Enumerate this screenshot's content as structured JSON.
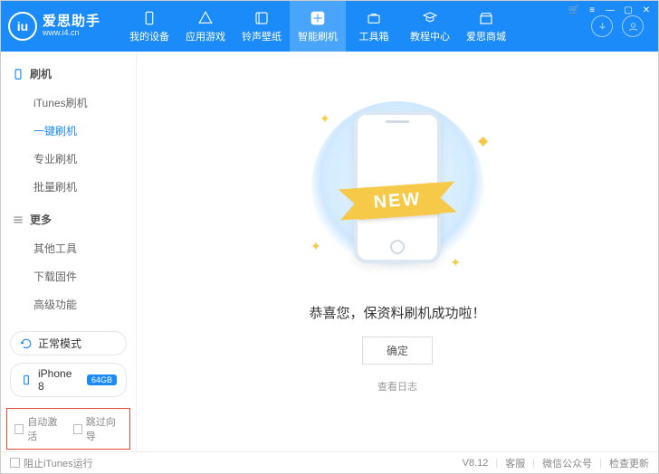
{
  "header": {
    "logo_text": "iu",
    "title": "爱思助手",
    "subtitle": "www.i4.cn",
    "nav": [
      {
        "label": "我的设备",
        "icon": "device"
      },
      {
        "label": "应用游戏",
        "icon": "apps"
      },
      {
        "label": "铃声壁纸",
        "icon": "ringtone"
      },
      {
        "label": "智能刷机",
        "icon": "flash",
        "active": true
      },
      {
        "label": "工具箱",
        "icon": "toolbox"
      },
      {
        "label": "教程中心",
        "icon": "tutorial"
      },
      {
        "label": "爱思商城",
        "icon": "store"
      }
    ]
  },
  "sidebar": {
    "section1": {
      "title": "刷机"
    },
    "items1": [
      {
        "label": "iTunes刷机"
      },
      {
        "label": "一键刷机",
        "active": true
      },
      {
        "label": "专业刷机"
      },
      {
        "label": "批量刷机"
      }
    ],
    "section2": {
      "title": "更多"
    },
    "items2": [
      {
        "label": "其他工具"
      },
      {
        "label": "下载固件"
      },
      {
        "label": "高级功能"
      }
    ],
    "mode": {
      "label": "正常模式"
    },
    "device": {
      "name": "iPhone 8",
      "storage": "64GB"
    },
    "checks": {
      "auto_activate": "自动激活",
      "skip_guide": "跳过向导"
    }
  },
  "main": {
    "ribbon": "NEW",
    "message": "恭喜您，保资料刷机成功啦！",
    "ok": "确定",
    "view_log": "查看日志"
  },
  "footer": {
    "block_itunes": "阻止iTunes运行",
    "version": "V8.12",
    "support": "客服",
    "wechat": "微信公众号",
    "update": "检查更新"
  }
}
